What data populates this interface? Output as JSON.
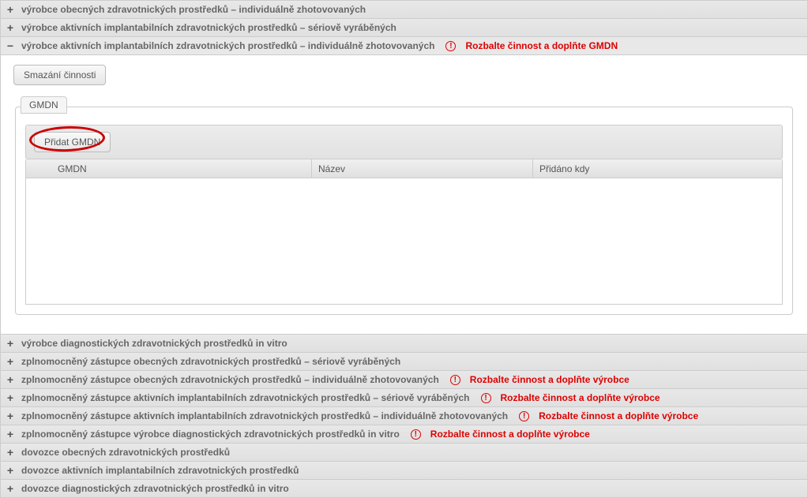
{
  "items": [
    {
      "title": "výrobce obecných zdravotnických prostředků – individuálně zhotovovaných",
      "warn": null,
      "expanded": false
    },
    {
      "title": "výrobce aktivních implantabilních zdravotnických prostředků – sériově vyráběných",
      "warn": null,
      "expanded": false
    },
    {
      "title": "výrobce aktivních implantabilních zdravotnických prostředků – individuálně zhotovovaných",
      "warn": "Rozbalte činnost a doplňte GMDN",
      "expanded": true
    },
    {
      "title": "výrobce diagnostických zdravotnických prostředků in vitro",
      "warn": null,
      "expanded": false
    },
    {
      "title": "zplnomocněný zástupce obecných zdravotnických prostředků – sériově vyráběných",
      "warn": null,
      "expanded": false
    },
    {
      "title": "zplnomocněný zástupce obecných zdravotnických prostředků – individuálně zhotovovaných",
      "warn": "Rozbalte činnost a doplňte výrobce",
      "expanded": false
    },
    {
      "title": "zplnomocněný zástupce aktivních implantabilních zdravotnických prostředků – sériově vyráběných",
      "warn": "Rozbalte činnost a doplňte výrobce",
      "expanded": false
    },
    {
      "title": "zplnomocněný zástupce aktivních implantabilních zdravotnických prostředků – individuálně zhotovovaných",
      "warn": "Rozbalte činnost a doplňte výrobce",
      "expanded": false
    },
    {
      "title": "zplnomocněný zástupce výrobce diagnostických zdravotnických prostředků in vitro",
      "warn": "Rozbalte činnost a doplňte výrobce",
      "expanded": false
    },
    {
      "title": "dovozce obecných zdravotnických prostředků",
      "warn": null,
      "expanded": false
    },
    {
      "title": "dovozce aktivních implantabilních zdravotnických prostředků",
      "warn": null,
      "expanded": false
    },
    {
      "title": "dovozce diagnostických zdravotnických prostředků in vitro",
      "warn": null,
      "expanded": false
    }
  ],
  "body": {
    "delete_btn": "Smazání činnosti",
    "gmdn_legend": "GMDN",
    "add_btn": "Přidat GMDN",
    "col_gmdn": "GMDN",
    "col_name": "Název",
    "col_added": "Přidáno kdy"
  },
  "icons": {
    "plus": "+",
    "minus": "−",
    "warn_glyph": "!"
  }
}
